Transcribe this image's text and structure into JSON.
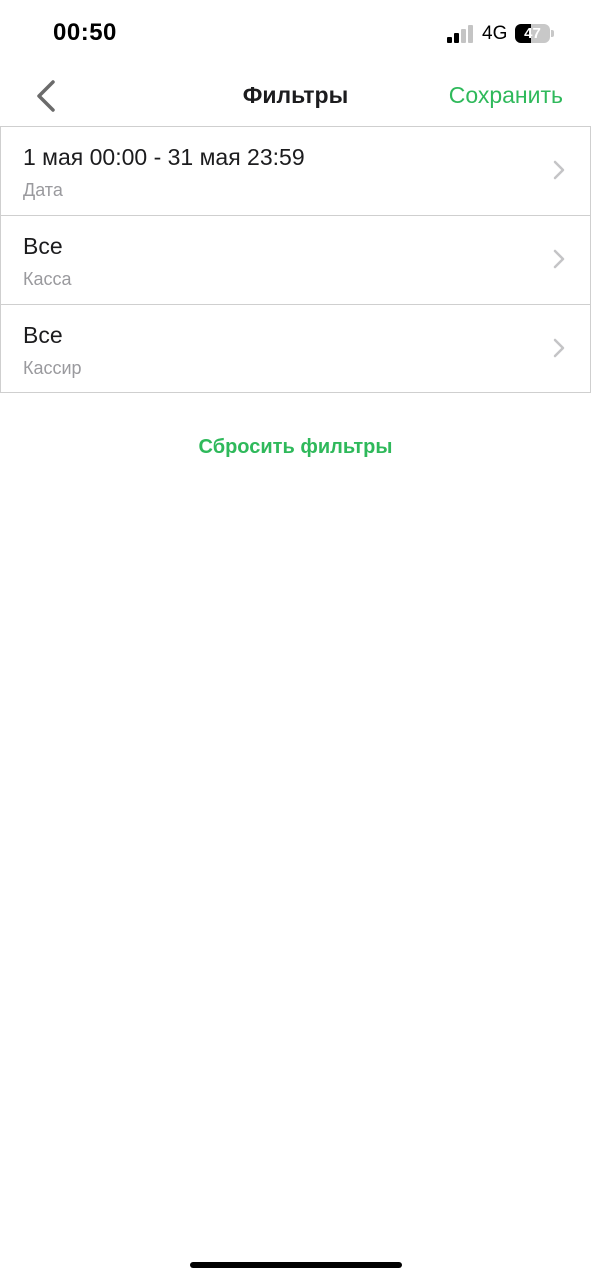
{
  "status_bar": {
    "time": "00:50",
    "network": "4G",
    "battery_level": "47",
    "battery_fraction": 0.47,
    "signal_bars_active": 2,
    "signal_bars_total": 4
  },
  "nav": {
    "title": "Фильтры",
    "save_label": "Сохранить",
    "back_icon": "chevron-left-icon"
  },
  "filters": [
    {
      "value": "1 мая 00:00 - 31 мая 23:59",
      "label": "Дата"
    },
    {
      "value": "Все",
      "label": "Касса"
    },
    {
      "value": "Все",
      "label": "Кассир"
    }
  ],
  "reset_label": "Сбросить фильтры",
  "colors": {
    "accent": "#2fb95b",
    "text_primary": "#1c1c1e",
    "text_secondary": "#9a9a9e",
    "divider": "#cfcfcf"
  }
}
